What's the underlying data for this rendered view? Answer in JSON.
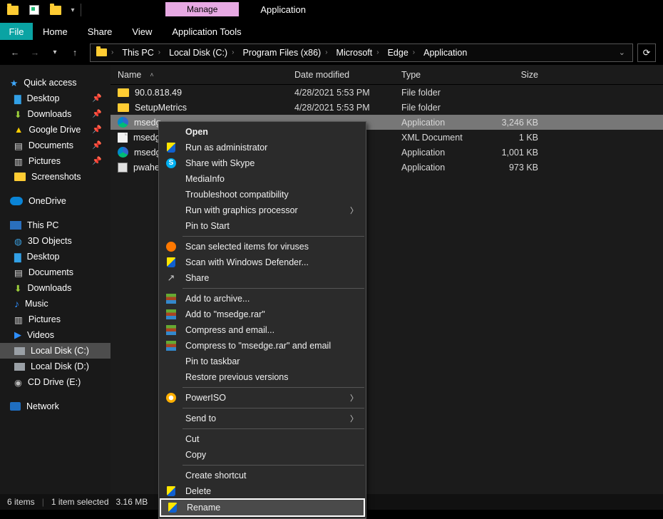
{
  "ribbon": {
    "context_manage": "Manage",
    "context_title": "Application",
    "file": "File",
    "tabs": [
      "Home",
      "Share",
      "View",
      "Application Tools"
    ]
  },
  "breadcrumb": {
    "items": [
      "This PC",
      "Local Disk (C:)",
      "Program Files (x86)",
      "Microsoft",
      "Edge",
      "Application"
    ]
  },
  "columns": {
    "name": "Name",
    "date": "Date modified",
    "type": "Type",
    "size": "Size"
  },
  "files": [
    {
      "icon": "folder",
      "name": "90.0.818.49",
      "date": "4/28/2021 5:53 PM",
      "type": "File folder",
      "size": ""
    },
    {
      "icon": "folder",
      "name": "SetupMetrics",
      "date": "4/28/2021 5:53 PM",
      "type": "File folder",
      "size": ""
    },
    {
      "icon": "edge",
      "name": "msedg",
      "date": "",
      "type": "Application",
      "size": "3,246 KB",
      "selected": true
    },
    {
      "icon": "xml",
      "name": "msedg",
      "date": "",
      "type": "XML Document",
      "size": "1 KB"
    },
    {
      "icon": "edge",
      "name": "msedg",
      "date": "",
      "type": "Application",
      "size": "1,001 KB"
    },
    {
      "icon": "dll",
      "name": "pwahe",
      "date": "",
      "type": "Application",
      "size": "973 KB"
    }
  ],
  "sidebar": {
    "quick_access": "Quick access",
    "quick_items": [
      "Desktop",
      "Downloads",
      "Google Drive",
      "Documents",
      "Pictures",
      "Screenshots"
    ],
    "onedrive": "OneDrive",
    "this_pc": "This PC",
    "pc_items": [
      "3D Objects",
      "Desktop",
      "Documents",
      "Downloads",
      "Music",
      "Pictures",
      "Videos",
      "Local Disk (C:)",
      "Local Disk (D:)",
      "CD Drive (E:)"
    ],
    "network": "Network"
  },
  "context_menu": {
    "open": "Open",
    "run_admin": "Run as administrator",
    "skype": "Share with Skype",
    "mediainfo": "MediaInfo",
    "troubleshoot": "Troubleshoot compatibility",
    "run_gfx": "Run with graphics processor",
    "pin_start": "Pin to Start",
    "scan_virus": "Scan selected items for viruses",
    "scan_defender": "Scan with Windows Defender...",
    "share": "Share",
    "add_archive": "Add to archive...",
    "add_rar": "Add to \"msedge.rar\"",
    "compress_email": "Compress and email...",
    "compress_rar_email": "Compress to \"msedge.rar\" and email",
    "pin_taskbar": "Pin to taskbar",
    "restore": "Restore previous versions",
    "poweriso": "PowerISO",
    "send_to": "Send to",
    "cut": "Cut",
    "copy": "Copy",
    "create_shortcut": "Create shortcut",
    "delete": "Delete",
    "rename": "Rename"
  },
  "status": {
    "items": "6 items",
    "selected": "1 item selected",
    "size": "3.16 MB"
  }
}
